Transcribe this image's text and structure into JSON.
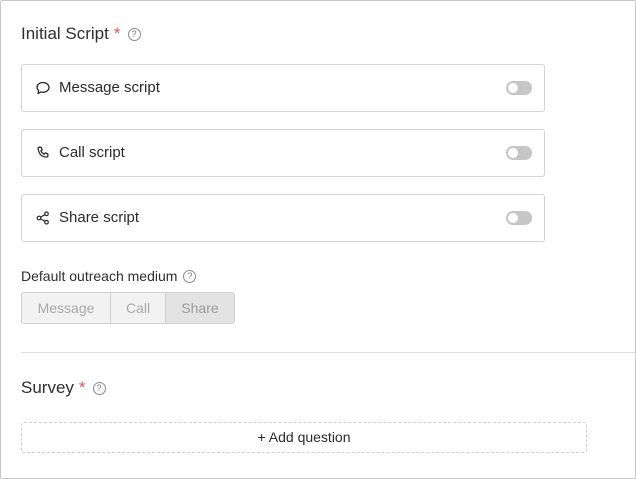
{
  "initial_script": {
    "title": "Initial Script",
    "required_mark": "*",
    "help_glyph": "?",
    "cards": [
      {
        "label": "Message script",
        "icon": "speech-bubble-icon",
        "enabled": false
      },
      {
        "label": "Call script",
        "icon": "phone-icon",
        "enabled": false
      },
      {
        "label": "Share script",
        "icon": "share-icon",
        "enabled": false
      }
    ]
  },
  "outreach": {
    "label": "Default outreach medium",
    "help_glyph": "?",
    "options": [
      "Message",
      "Call",
      "Share"
    ],
    "selected": "Share"
  },
  "survey": {
    "title": "Survey",
    "required_mark": "*",
    "help_glyph": "?",
    "add_question_label": "+ Add question"
  },
  "colors": {
    "required": "#e0554f",
    "toggle_off": "#c6c6c6",
    "border": "#d4d4d4"
  }
}
